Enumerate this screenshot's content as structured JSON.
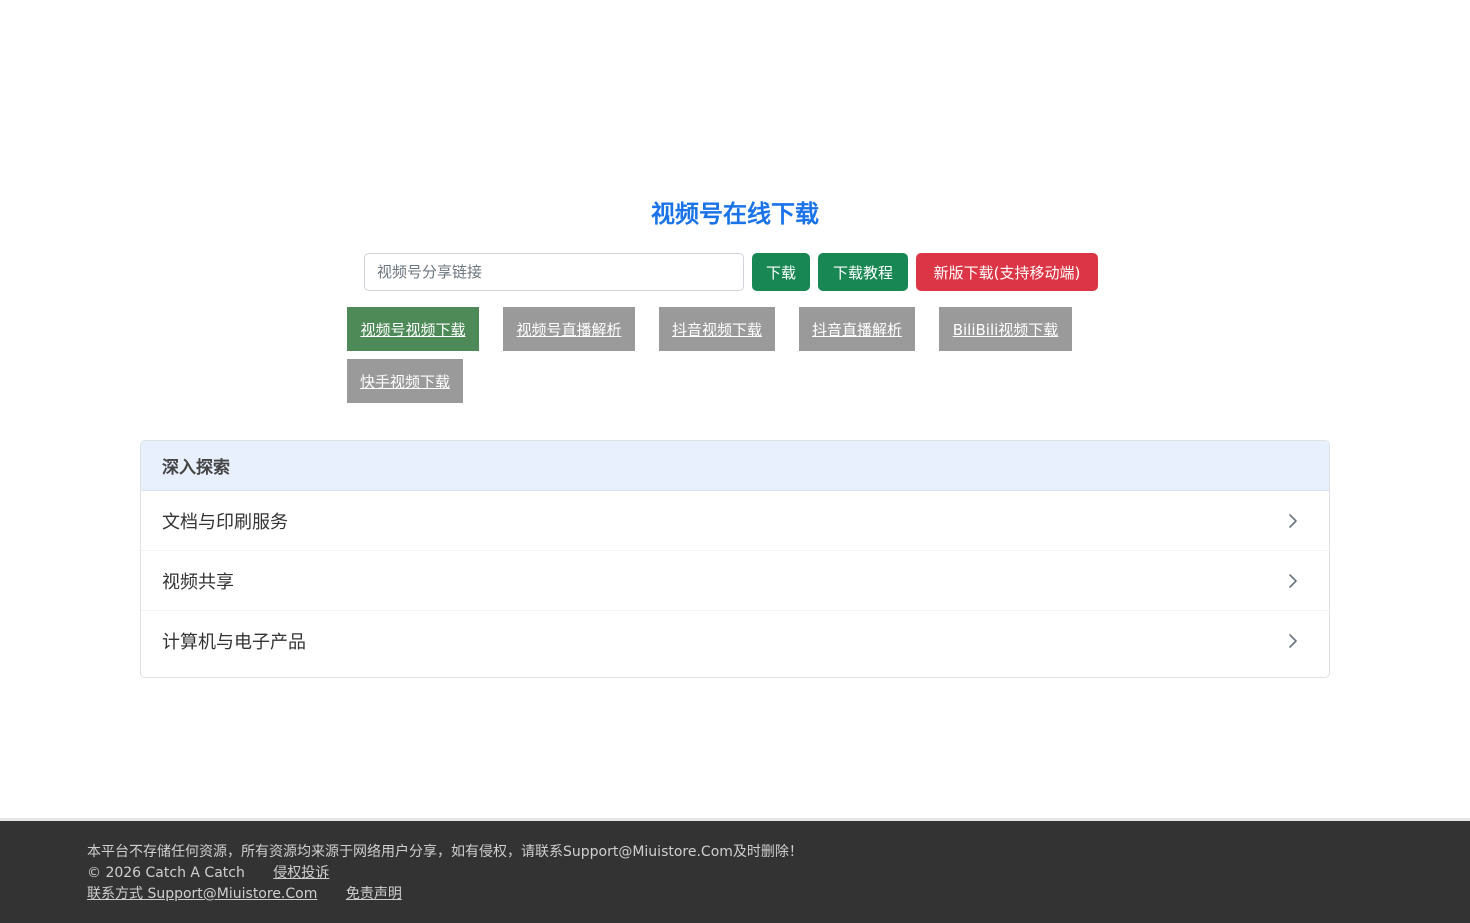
{
  "page": {
    "title": "视频号在线下载"
  },
  "search": {
    "placeholder": "视频号分享链接",
    "download_label": "下载",
    "tutorial_label": "下载教程",
    "new_version_label": "新版下载(支持移动端)"
  },
  "tabs": [
    {
      "label": "视频号视频下载",
      "active": true
    },
    {
      "label": "视频号直播解析",
      "active": false
    },
    {
      "label": "抖音视频下载",
      "active": false
    },
    {
      "label": "抖音直播解析",
      "active": false
    },
    {
      "label": "BiliBili视频下载",
      "active": false
    },
    {
      "label": "快手视频下载",
      "active": false
    }
  ],
  "explore": {
    "header": "深入探索",
    "items": [
      {
        "label": "文档与印刷服务",
        "icon": "chevron-right-icon"
      },
      {
        "label": "视频共享",
        "icon": "chevron-right-icon"
      },
      {
        "label": "计算机与电子产品",
        "icon": "chevron-right-icon"
      }
    ]
  },
  "footer": {
    "disclaimer": "本平台不存储任何资源，所有资源均来源于网络用户分享，如有侵权，请联系Support@Miuistore.Com及时删除！",
    "copyright": "© 2026 Catch A Catch",
    "complaint_link": "侵权投诉",
    "contact_link": "联系方式 Support@Miuistore.Com",
    "statement_link": "免责声明"
  },
  "colors": {
    "title": "#1a73e8",
    "green_button": "#198754",
    "red_button": "#dc3545",
    "active_tab": "#4e8a58",
    "inactive_tab": "#9a9a9a",
    "card_header": "#e8f0fe",
    "footer_bg": "#333333"
  }
}
